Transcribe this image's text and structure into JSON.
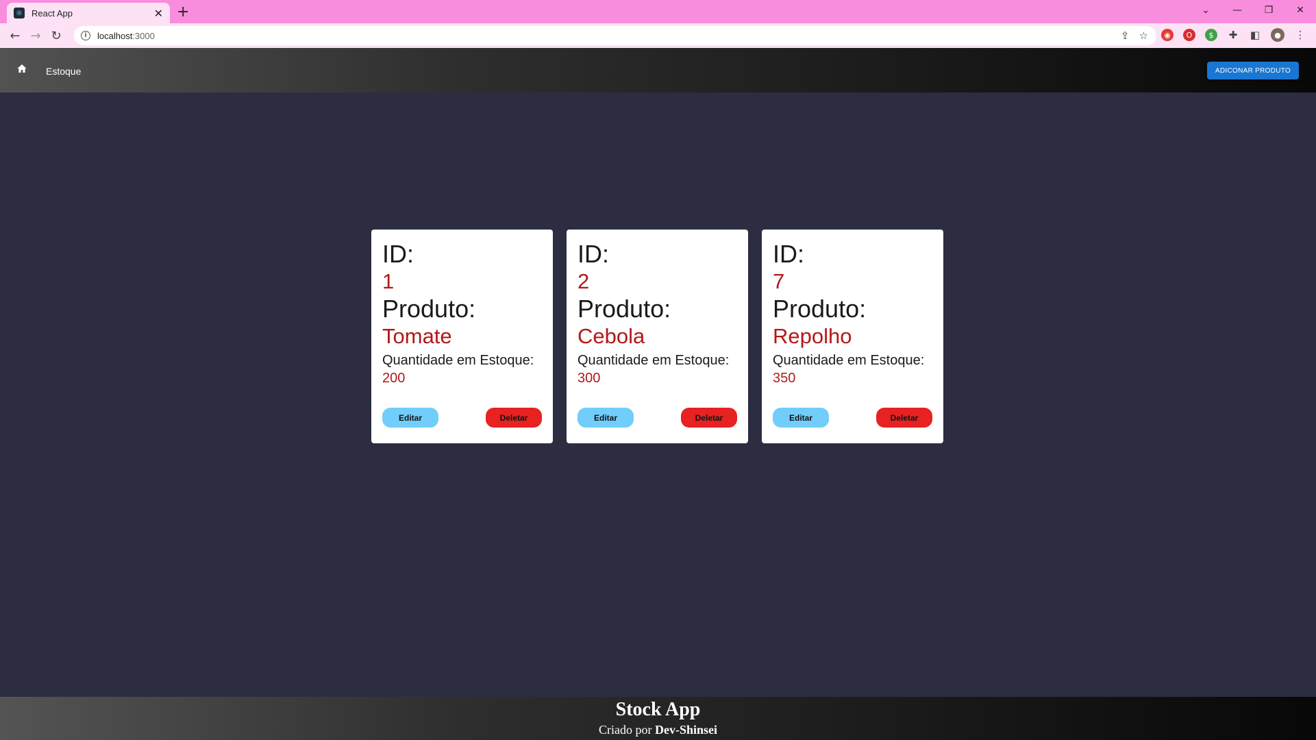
{
  "browser": {
    "tab_title": "React App",
    "tab_close": "✕",
    "new_tab": "+",
    "url_host": "localhost",
    "url_port": ":3000"
  },
  "header": {
    "nav_label": "Estoque",
    "add_button": "ADICONAR PRODUTO"
  },
  "cards": [
    {
      "id_label": "ID:",
      "id": "1",
      "product_label": "Produto:",
      "product": "Tomate",
      "qty_label": "Quantidade em Estoque:",
      "qty": "200",
      "edit": "Editar",
      "delete": "Deletar"
    },
    {
      "id_label": "ID:",
      "id": "2",
      "product_label": "Produto:",
      "product": "Cebola",
      "qty_label": "Quantidade em Estoque:",
      "qty": "300",
      "edit": "Editar",
      "delete": "Deletar"
    },
    {
      "id_label": "ID:",
      "id": "7",
      "product_label": "Produto:",
      "product": "Repolho",
      "qty_label": "Quantidade em Estoque:",
      "qty": "350",
      "edit": "Editar",
      "delete": "Deletar"
    }
  ],
  "footer": {
    "title": "Stock App",
    "credit_prefix": "Criado por ",
    "credit_name": "Dev-Shinsei"
  },
  "colors": {
    "value_red": "#b41818",
    "edit_button": "#71cdfa",
    "delete_button": "#e82121",
    "add_button": "#1976d2",
    "background": "#2c2d40"
  }
}
